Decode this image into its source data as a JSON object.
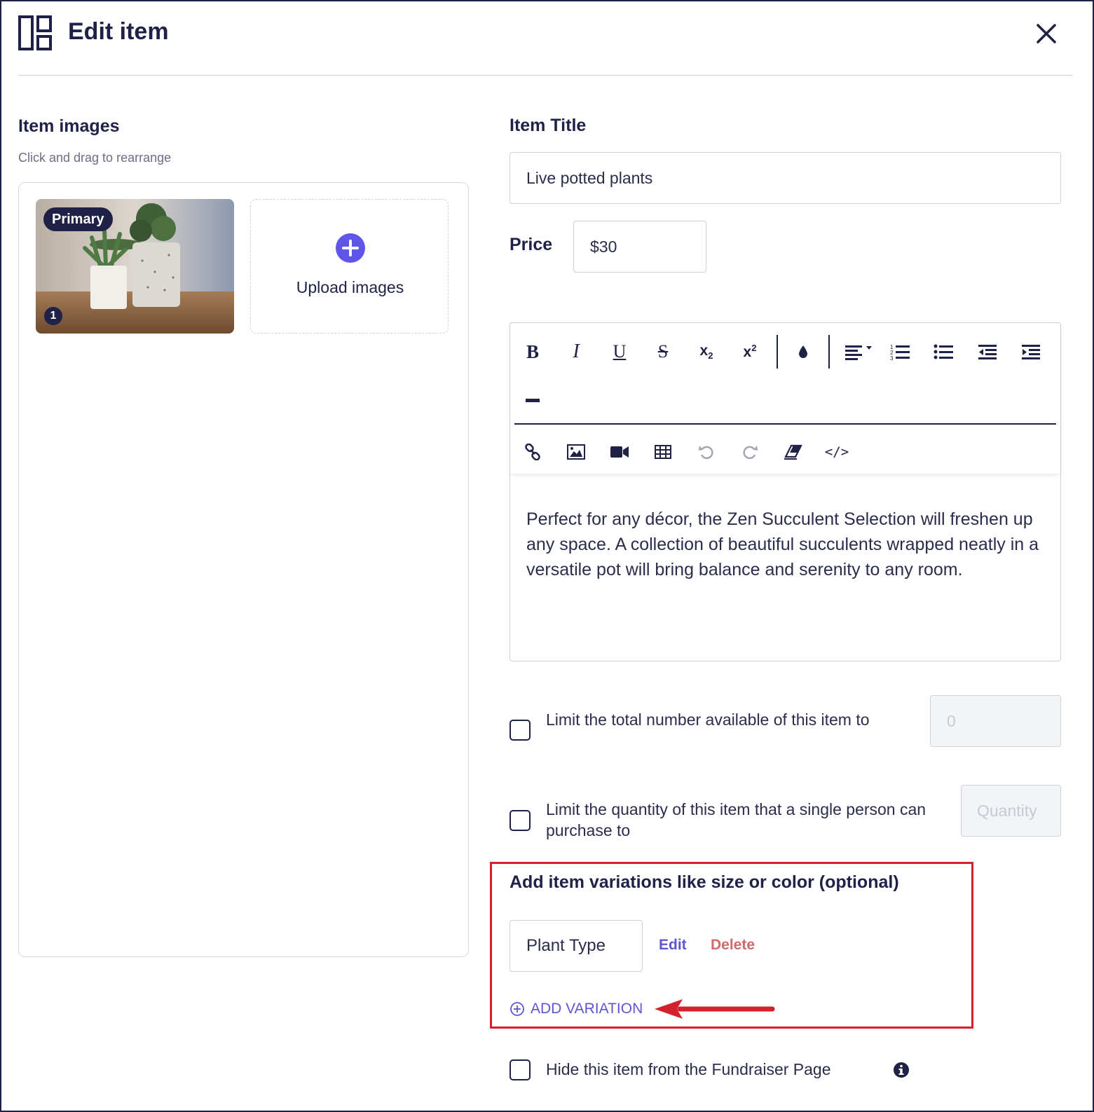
{
  "header": {
    "title": "Edit item",
    "layout_icon": "layout-panels-icon",
    "close_icon": "close-icon"
  },
  "images_section": {
    "heading": "Item images",
    "hint": "Click and drag to rearrange",
    "primary_badge": "Primary",
    "position_badge": "1",
    "upload_label": "Upload images",
    "upload_icon": "plus-circle-icon"
  },
  "item_title": {
    "label": "Item Title",
    "value": "Live potted plants"
  },
  "price": {
    "label": "Price",
    "value": "$30"
  },
  "editor": {
    "toolbar_row1": [
      "bold-icon",
      "italic-icon",
      "underline-icon",
      "strikethrough-icon",
      "subscript-icon",
      "superscript-icon",
      "text-color-icon",
      "align-icon",
      "ordered-list-icon",
      "unordered-list-icon",
      "outdent-icon",
      "indent-icon",
      "horizontal-rule-icon"
    ],
    "toolbar_row2": [
      "link-icon",
      "image-icon",
      "video-icon",
      "table-icon",
      "undo-icon",
      "redo-icon",
      "clear-format-icon",
      "code-view-icon"
    ],
    "content": "Perfect for any décor, the Zen Succulent Selection will freshen up any space. A collection of beautiful succulents wrapped neatly in a versatile pot will bring balance and serenity to any room."
  },
  "limit_total": {
    "label": "Limit the total number available of this item to",
    "placeholder": "0",
    "checked": false
  },
  "limit_per_person": {
    "label": "Limit the quantity of this item that a single person can purchase to",
    "placeholder": "Quantity",
    "checked": false
  },
  "variations": {
    "heading": "Add item variations like size or color (optional)",
    "items": [
      {
        "name": "Plant Type",
        "edit_label": "Edit",
        "delete_label": "Delete"
      }
    ],
    "add_label": "ADD VARIATION",
    "highlight_color": "#d4202a"
  },
  "hide_item": {
    "label": "Hide this item from the Fundraiser Page",
    "checked": false,
    "info_icon": "info-icon"
  },
  "colors": {
    "navy": "#1f2147",
    "accent": "#5f55e8",
    "danger": "#d16a6a"
  }
}
